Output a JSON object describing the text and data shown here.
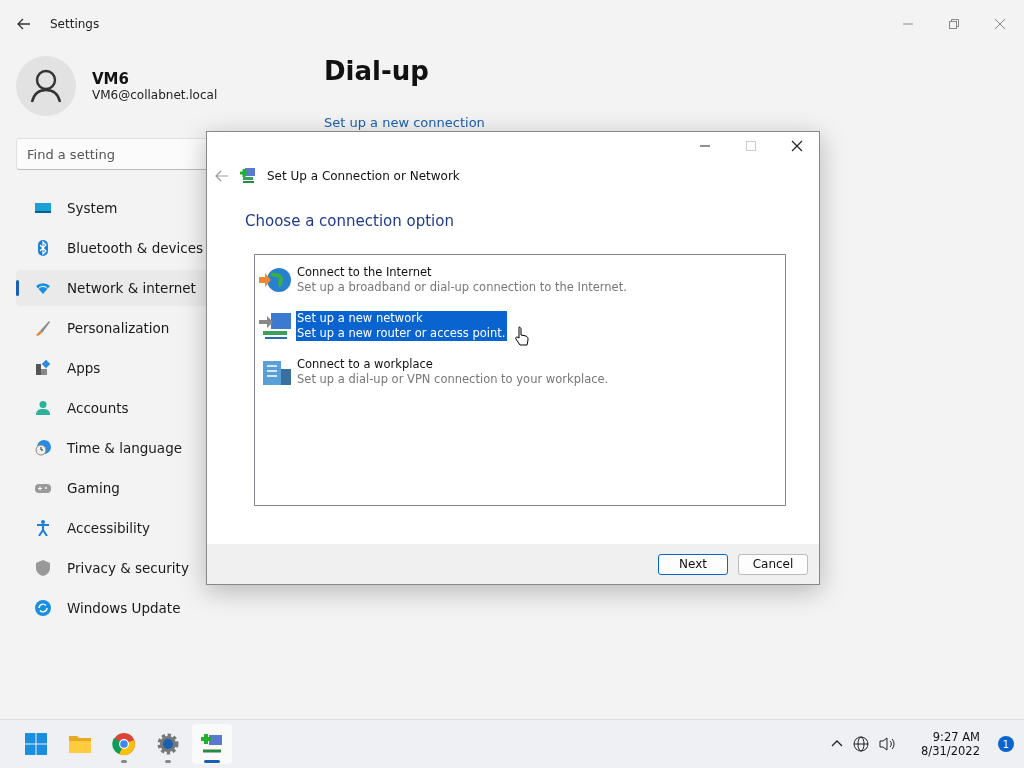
{
  "settings": {
    "title": "Settings",
    "user": {
      "name": "VM6",
      "email": "VM6@collabnet.local"
    },
    "search": {
      "placeholder": "Find a setting"
    },
    "nav": [
      {
        "label": "System",
        "selected": false
      },
      {
        "label": "Bluetooth & devices",
        "selected": false
      },
      {
        "label": "Network & internet",
        "selected": true
      },
      {
        "label": "Personalization",
        "selected": false
      },
      {
        "label": "Apps",
        "selected": false
      },
      {
        "label": "Accounts",
        "selected": false
      },
      {
        "label": "Time & language",
        "selected": false
      },
      {
        "label": "Gaming",
        "selected": false
      },
      {
        "label": "Accessibility",
        "selected": false
      },
      {
        "label": "Privacy & security",
        "selected": false
      },
      {
        "label": "Windows Update",
        "selected": false
      }
    ],
    "page_title": "Dial-up",
    "link": "Set up a new connection"
  },
  "dialog": {
    "title": "Set Up a Connection or Network",
    "heading": "Choose a connection option",
    "options": [
      {
        "title": "Connect to the Internet",
        "description": "Set up a broadband or dial-up connection to the Internet.",
        "selected": false
      },
      {
        "title": "Set up a new network",
        "description": "Set up a new router or access point.",
        "selected": true
      },
      {
        "title": "Connect to a workplace",
        "description": "Set up a dial-up or VPN connection to your workplace.",
        "selected": false
      }
    ],
    "buttons": [
      {
        "label": "Next",
        "default": true
      },
      {
        "label": "Cancel",
        "default": false
      }
    ]
  },
  "taskbar": {
    "apps": [
      {
        "running": false,
        "active": false
      },
      {
        "running": false,
        "active": false
      },
      {
        "running": true,
        "active": false
      },
      {
        "running": true,
        "active": false
      },
      {
        "running": true,
        "active": true
      }
    ],
    "time": "9:27 AM",
    "date": "8/31/2022",
    "notifications": "1"
  }
}
